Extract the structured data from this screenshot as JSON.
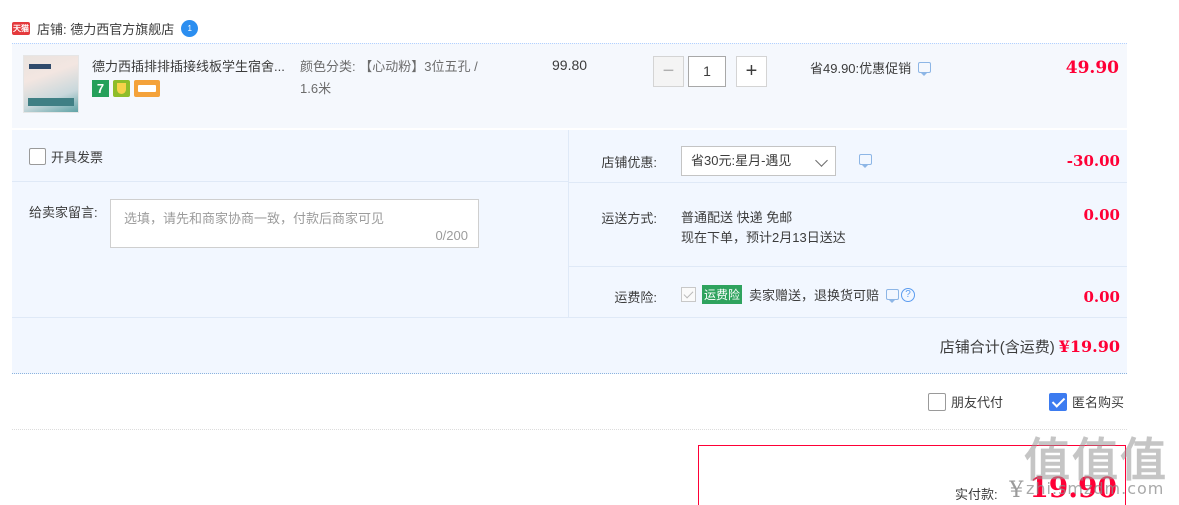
{
  "shop": {
    "badge": "天猫",
    "name": "店铺: 德力西官方旗舰店",
    "chat_badge": "1"
  },
  "item": {
    "title": "德力西插排排插接线板学生宿舍...",
    "sku_line1": "颜色分类: 【心动粉】3位五孔 /",
    "sku_line2": "1.6米",
    "unit_price": "99.80",
    "badge_seven": "7",
    "quantity": "1",
    "minus": "−",
    "plus": "+",
    "promo": "省49.90:优惠促销",
    "total": "49.90"
  },
  "order": {
    "invoice_label": "开具发票",
    "memo_label": "给卖家留言:",
    "memo_placeholder": "选填，请先和商家协商一致，付款后商家可见",
    "memo_count": "0/200",
    "coupon_label": "店铺优惠:",
    "coupon_value": "省30元:星月-遇见",
    "coupon_amount": "-30.00",
    "shipping_label": "运送方式:",
    "shipping_line1": "普通配送 快递 免邮",
    "shipping_line2": "现在下单，预计2月13日送达",
    "shipping_amount": "0.00",
    "insurance_label": "运费险:",
    "insurance_tag": "运费险",
    "insurance_text": "卖家赠送，退换货可赔",
    "insurance_amount": "0.00",
    "help": "?",
    "shop_total_label": "店铺合计(含运费)",
    "shop_total_value": "¥19.90"
  },
  "options": {
    "friend_pay": "朋友代付",
    "anonymous": "匿名购买",
    "anonymous_checked": true
  },
  "payment": {
    "label": "实付款:",
    "yen": "¥",
    "amount": "19.90"
  },
  "watermark": {
    "glyph": "值",
    "site": "zhi.smzdm.com"
  },
  "colors": {
    "price_red": "#ff0036",
    "panel_bg": "#f2f7ff",
    "item_bg": "#f5f8fd",
    "checkbox_blue": "#3c7bf0",
    "tmall_red": "#e4393c"
  }
}
